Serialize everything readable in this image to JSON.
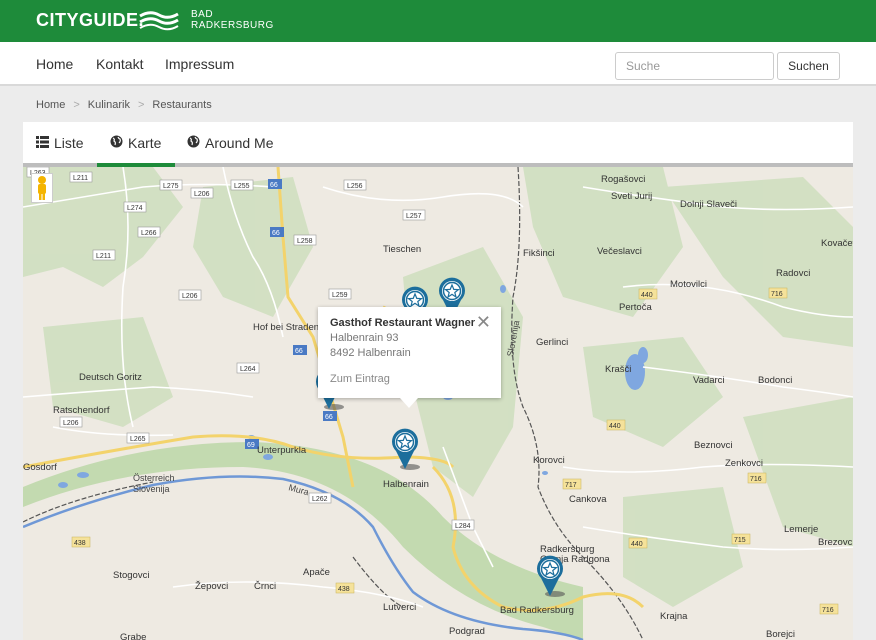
{
  "header": {
    "logo": "CITYGUIDE.",
    "city_line1": "BAD",
    "city_line2": "RADKERSBURG"
  },
  "nav": {
    "items": [
      "Home",
      "Kontakt",
      "Impressum"
    ],
    "search_placeholder": "Suche",
    "search_button": "Suchen"
  },
  "breadcrumb": [
    "Home",
    "Kulinarik",
    "Restaurants"
  ],
  "tabs": [
    {
      "label": "Liste",
      "icon": "list-icon",
      "active": false
    },
    {
      "label": "Karte",
      "icon": "globe-icon",
      "active": true
    },
    {
      "label": "Around Me",
      "icon": "globe-icon",
      "active": false
    }
  ],
  "popup": {
    "title": "Gasthof Restaurant Wagner",
    "line1": "Halbenrain 93",
    "line2": "8492 Halbenrain",
    "link": "Zum Eintrag",
    "close": "✕"
  },
  "map": {
    "towns": [
      "Tieschen",
      "Hof bei Straden",
      "Deutsch Goritz",
      "Ratschendorf",
      "Unterpurkla",
      "Halbenrain",
      "Gosdorf",
      "Österreich",
      "Slovenija",
      "Mura",
      "Radkersburg",
      "Bad Radkersburg",
      "Gornja Radgona",
      "Lutverci",
      "Podgrad",
      "Apače",
      "Žepovci",
      "Črnci",
      "Stogovci",
      "Grabe",
      "Krajna",
      "Borejci",
      "Rogašovci",
      "Sveti Jurij",
      "Dolnji Slaveči",
      "Fikšinci",
      "Večeslavci",
      "Kovačev",
      "Motovilci",
      "Radovci",
      "Pertoča",
      "Gerlinci",
      "Krašči",
      "Vadarci",
      "Bodonci",
      "Beznovci",
      "Korovci",
      "Zenkovci",
      "Cankova",
      "Lemerje",
      "Brezovci",
      "Slovenija"
    ],
    "roads": [
      "L263",
      "L211",
      "L275",
      "L255",
      "L256",
      "L206",
      "L274",
      "L257",
      "L266",
      "L258",
      "L211",
      "L206",
      "L259",
      "L264",
      "L206",
      "L265",
      "L262",
      "L284",
      "66",
      "66",
      "66",
      "66",
      "69",
      "440",
      "716",
      "440",
      "716",
      "717",
      "715",
      "716",
      "438",
      "438",
      "440"
    ]
  }
}
